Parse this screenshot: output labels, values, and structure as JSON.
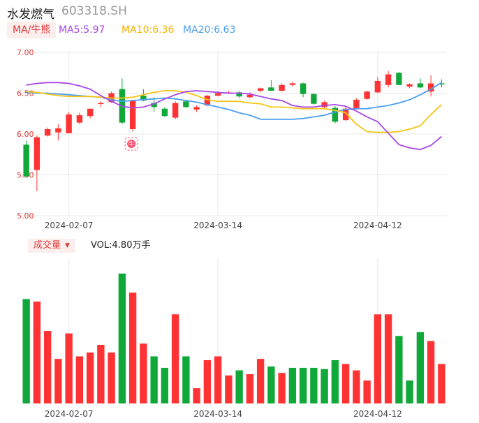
{
  "header": {
    "name": "水发燃气",
    "code": "603318.SH"
  },
  "ma": {
    "button_label": "MA/牛熊",
    "ma5": "MA5:5.97",
    "ma10": "MA10:6.36",
    "ma20": "MA20:6.63"
  },
  "colors": {
    "up": "#ff3333",
    "down": "#11a83a",
    "ma5": "#a847e8",
    "ma10": "#f5c518",
    "ma20": "#4b9ff0",
    "grid": "#e8e8e8",
    "axis_text": "#e03a3a"
  },
  "volume": {
    "button_label": "成交量",
    "caret": "▼",
    "vol_label": "VOL:4.80万手"
  },
  "icons": {
    "bull_icon": "bull-badge-icon"
  },
  "chart_data": [
    {
      "type": "candlestick",
      "y_ticks": [
        "7.00",
        "6.50",
        "6.00",
        "5.50",
        "5.00"
      ],
      "ylim": [
        5.0,
        7.0
      ],
      "x_tick_labels": [
        "2024-02-07",
        "2024-03-14",
        "2024-04-12"
      ],
      "x_tick_index": [
        4,
        18,
        33
      ],
      "candles": [
        {
          "o": 5.87,
          "h": 5.92,
          "l": 5.49,
          "c": 5.48
        },
        {
          "o": 5.56,
          "h": 5.98,
          "l": 5.3,
          "c": 5.96
        },
        {
          "o": 5.98,
          "h": 6.08,
          "l": 5.97,
          "c": 6.06
        },
        {
          "o": 6.02,
          "h": 6.12,
          "l": 5.92,
          "c": 6.07
        },
        {
          "o": 6.01,
          "h": 6.27,
          "l": 6.01,
          "c": 6.24
        },
        {
          "o": 6.14,
          "h": 6.26,
          "l": 6.12,
          "c": 6.23
        },
        {
          "o": 6.22,
          "h": 6.31,
          "l": 6.19,
          "c": 6.31
        },
        {
          "o": 6.37,
          "h": 6.4,
          "l": 6.33,
          "c": 6.38
        },
        {
          "o": 6.39,
          "h": 6.52,
          "l": 6.38,
          "c": 6.5
        },
        {
          "o": 6.55,
          "h": 6.68,
          "l": 6.12,
          "c": 6.14
        },
        {
          "o": 6.06,
          "h": 6.42,
          "l": 6.03,
          "c": 6.41
        },
        {
          "o": 6.47,
          "h": 6.55,
          "l": 6.4,
          "c": 6.41
        },
        {
          "o": 6.38,
          "h": 6.45,
          "l": 6.27,
          "c": 6.33
        },
        {
          "o": 6.31,
          "h": 6.33,
          "l": 6.21,
          "c": 6.22
        },
        {
          "o": 6.2,
          "h": 6.4,
          "l": 6.18,
          "c": 6.38
        },
        {
          "o": 6.4,
          "h": 6.42,
          "l": 6.32,
          "c": 6.33
        },
        {
          "o": 6.3,
          "h": 6.35,
          "l": 6.27,
          "c": 6.33
        },
        {
          "o": 6.35,
          "h": 6.48,
          "l": 6.34,
          "c": 6.47
        },
        {
          "o": 6.47,
          "h": 6.52,
          "l": 6.46,
          "c": 6.5
        },
        {
          "o": 6.51,
          "h": 6.53,
          "l": 6.5,
          "c": 6.51
        },
        {
          "o": 6.51,
          "h": 6.53,
          "l": 6.44,
          "c": 6.46
        },
        {
          "o": 6.45,
          "h": 6.51,
          "l": 6.44,
          "c": 6.48
        },
        {
          "o": 6.53,
          "h": 6.57,
          "l": 6.51,
          "c": 6.56
        },
        {
          "o": 6.57,
          "h": 6.66,
          "l": 6.55,
          "c": 6.53
        },
        {
          "o": 6.53,
          "h": 6.62,
          "l": 6.52,
          "c": 6.6
        },
        {
          "o": 6.6,
          "h": 6.64,
          "l": 6.58,
          "c": 6.62
        },
        {
          "o": 6.62,
          "h": 6.63,
          "l": 6.45,
          "c": 6.49
        },
        {
          "o": 6.49,
          "h": 6.5,
          "l": 6.36,
          "c": 6.37
        },
        {
          "o": 6.33,
          "h": 6.41,
          "l": 6.31,
          "c": 6.39
        },
        {
          "o": 6.32,
          "h": 6.34,
          "l": 6.13,
          "c": 6.15
        },
        {
          "o": 6.17,
          "h": 6.33,
          "l": 6.16,
          "c": 6.31
        },
        {
          "o": 6.31,
          "h": 6.44,
          "l": 6.3,
          "c": 6.42
        },
        {
          "o": 6.43,
          "h": 6.53,
          "l": 6.42,
          "c": 6.52
        },
        {
          "o": 6.51,
          "h": 6.7,
          "l": 6.5,
          "c": 6.65
        },
        {
          "o": 6.6,
          "h": 6.77,
          "l": 6.57,
          "c": 6.73
        },
        {
          "o": 6.75,
          "h": 6.76,
          "l": 6.6,
          "c": 6.6
        },
        {
          "o": 6.58,
          "h": 6.62,
          "l": 6.56,
          "c": 6.61
        },
        {
          "o": 6.62,
          "h": 6.68,
          "l": 6.56,
          "c": 6.57
        },
        {
          "o": 6.52,
          "h": 6.72,
          "l": 6.46,
          "c": 6.62
        },
        {
          "o": 6.62,
          "h": 6.67,
          "l": 6.57,
          "c": 6.61
        }
      ],
      "ma_lines": {
        "ma5": [
          6.6,
          6.62,
          6.63,
          6.63,
          6.62,
          6.59,
          6.55,
          6.47,
          6.4,
          6.34,
          6.32,
          6.33,
          6.37,
          6.43,
          6.48,
          6.52,
          6.53,
          6.52,
          6.51,
          6.5,
          6.5,
          6.49,
          6.46,
          6.43,
          6.41,
          6.35,
          6.33,
          6.33,
          6.35,
          6.36,
          6.34,
          6.28,
          6.21,
          6.15,
          6.01,
          5.87,
          5.83,
          5.81,
          5.86,
          5.97
        ],
        "ma10": [
          6.52,
          6.51,
          6.49,
          6.47,
          6.46,
          6.46,
          6.46,
          6.45,
          6.44,
          6.44,
          6.45,
          6.48,
          6.51,
          6.53,
          6.53,
          6.51,
          6.47,
          6.42,
          6.4,
          6.4,
          6.4,
          6.38,
          6.37,
          6.33,
          6.33,
          6.32,
          6.31,
          6.31,
          6.31,
          6.29,
          6.26,
          6.12,
          6.03,
          6.02,
          6.02,
          6.03,
          6.06,
          6.1,
          6.24,
          6.36
        ],
        "ma20": [
          6.51,
          6.5,
          6.5,
          6.49,
          6.48,
          6.47,
          6.46,
          6.45,
          6.42,
          6.4,
          6.41,
          6.42,
          6.43,
          6.44,
          6.43,
          6.41,
          6.39,
          6.36,
          6.33,
          6.3,
          6.26,
          6.23,
          6.18,
          6.18,
          6.18,
          6.18,
          6.19,
          6.21,
          6.23,
          6.27,
          6.3,
          6.31,
          6.31,
          6.33,
          6.35,
          6.38,
          6.42,
          6.48,
          6.55,
          6.63
        ]
      },
      "bull_marker_index": 10
    },
    {
      "type": "bar",
      "title": "成交量",
      "values": [
        8.2,
        8.0,
        5.7,
        3.5,
        5.5,
        3.7,
        4.0,
        4.6,
        4.0,
        10.2,
        8.7,
        4.7,
        3.7,
        2.8,
        7.0,
        3.7,
        1.2,
        3.4,
        3.7,
        2.2,
        2.6,
        2.3,
        3.5,
        2.9,
        2.4,
        2.8,
        2.8,
        2.8,
        2.7,
        3.4,
        3.1,
        2.6,
        1.8,
        7.0,
        7.0,
        5.3,
        1.8,
        5.6,
        4.9,
        3.1
      ],
      "up": [
        false,
        true,
        true,
        true,
        true,
        true,
        true,
        true,
        true,
        false,
        true,
        true,
        false,
        false,
        true,
        false,
        true,
        true,
        true,
        true,
        false,
        true,
        true,
        false,
        true,
        false,
        false,
        false,
        false,
        false,
        true,
        true,
        true,
        true,
        true,
        false,
        false,
        false,
        true,
        true
      ],
      "x_tick_labels": [
        "2024-02-07",
        "2024-03-14",
        "2024-04-12"
      ],
      "x_tick_index": [
        4,
        18,
        33
      ]
    }
  ]
}
